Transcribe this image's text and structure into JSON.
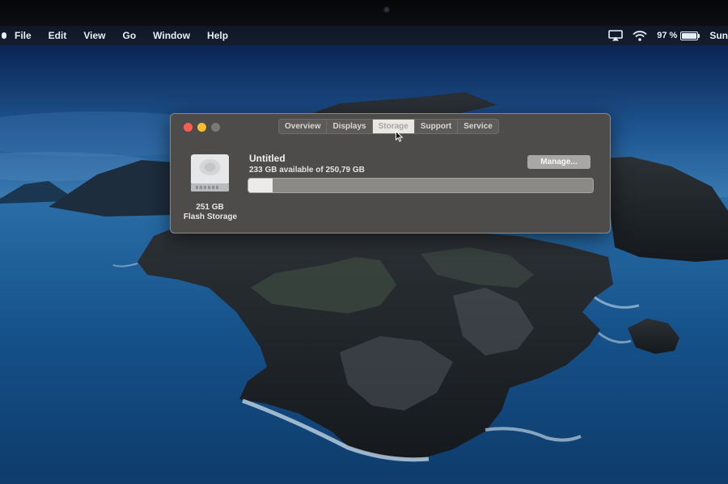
{
  "menubar": {
    "menus": [
      "File",
      "Edit",
      "View",
      "Go",
      "Window",
      "Help"
    ],
    "status_icons": [
      "airplay-icon",
      "wifi-icon",
      "battery-icon"
    ],
    "battery_percent": "97 %",
    "battery_level": 0.97,
    "day": "Sun"
  },
  "window": {
    "tabs": [
      {
        "label": "Overview",
        "active": false
      },
      {
        "label": "Displays",
        "active": false
      },
      {
        "label": "Storage",
        "active": true
      },
      {
        "label": "Support",
        "active": false
      },
      {
        "label": "Service",
        "active": false
      }
    ],
    "disk": {
      "icon": "hard-drive-icon",
      "size_label": "251 GB",
      "type_label": "Flash Storage"
    },
    "volume": {
      "name": "Untitled",
      "available_text": "233 GB available of 250,79 GB",
      "used_fraction": 0.07
    },
    "manage_label": "Manage...",
    "colors": {
      "close": "#ff5b51",
      "minimize": "#f6be2f",
      "zoom": "#7a7875",
      "window_bg": "#4e4c4b"
    }
  }
}
